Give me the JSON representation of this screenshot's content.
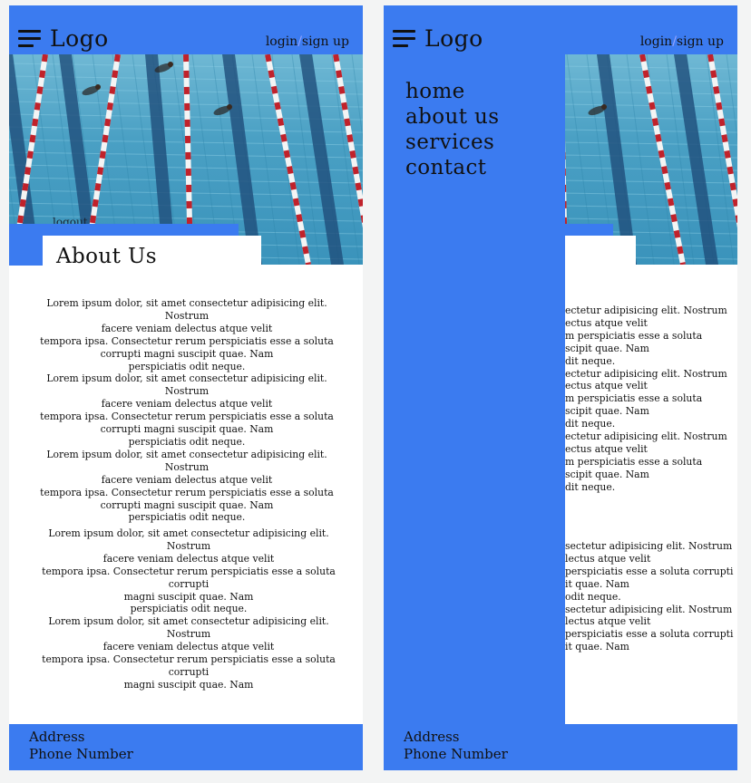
{
  "header": {
    "logo": "Logo",
    "login": "login",
    "slash": "/",
    "signup": "sign up"
  },
  "hero": {
    "logout_text": "logout"
  },
  "about": {
    "title": "About Us"
  },
  "paragraphs_left": {
    "block1": [
      "Lorem ipsum dolor, sit amet consectetur adipisicing elit. Nostrum",
      "facere veniam delectus atque velit",
      "tempora ipsa. Consectetur rerum perspiciatis esse a soluta",
      "corrupti magni suscipit quae. Nam",
      "perspiciatis odit neque.",
      "Lorem ipsum dolor, sit amet consectetur adipisicing elit. Nostrum",
      "facere veniam delectus atque velit",
      "tempora ipsa. Consectetur rerum perspiciatis esse a soluta",
      "corrupti magni suscipit quae. Nam",
      "perspiciatis odit neque.",
      "Lorem ipsum dolor, sit amet consectetur adipisicing elit. Nostrum",
      "facere veniam delectus atque velit",
      "tempora ipsa. Consectetur rerum perspiciatis esse a soluta",
      "corrupti magni suscipit quae. Nam",
      "perspiciatis odit neque."
    ],
    "block2": [
      "Lorem ipsum dolor, sit amet consectetur adipisicing elit. Nostrum",
      "facere veniam delectus atque velit",
      "tempora ipsa. Consectetur rerum perspiciatis esse a soluta corrupti",
      "magni suscipit quae. Nam",
      "perspiciatis odit neque.",
      "Lorem ipsum dolor, sit amet consectetur adipisicing elit. Nostrum",
      "facere veniam delectus atque velit",
      "tempora ipsa. Consectetur rerum perspiciatis esse a soluta corrupti",
      "magni suscipit quae. Nam"
    ]
  },
  "paragraphs_right": {
    "block1": [
      "ectetur adipisicing elit. Nostrum",
      "ectus atque velit",
      "m perspiciatis esse a soluta",
      "scipit quae. Nam",
      "dit neque.",
      "ectetur adipisicing elit. Nostrum",
      "ectus atque velit",
      "m perspiciatis esse a soluta",
      "scipit quae. Nam",
      "dit neque.",
      "ectetur adipisicing elit. Nostrum",
      "ectus atque velit",
      "m perspiciatis esse a soluta",
      "scipit quae. Nam",
      "dit neque."
    ],
    "block2": [
      "sectetur adipisicing elit. Nostrum",
      "lectus atque velit",
      "perspiciatis esse a soluta corrupti",
      "it quae. Nam",
      "odit neque.",
      "sectetur adipisicing elit. Nostrum",
      "lectus atque velit",
      "perspiciatis esse a soluta corrupti",
      "it quae. Nam"
    ]
  },
  "drawer": {
    "items": [
      "home",
      "about us",
      "services",
      "contact"
    ]
  },
  "footer": {
    "address": "Address",
    "phone": "Phone Number"
  },
  "colors": {
    "brand_blue": "#3b7bf0",
    "page_background": "#f3f4f4",
    "text": "#111111"
  },
  "icons": [
    "hamburger-menu-icon"
  ]
}
